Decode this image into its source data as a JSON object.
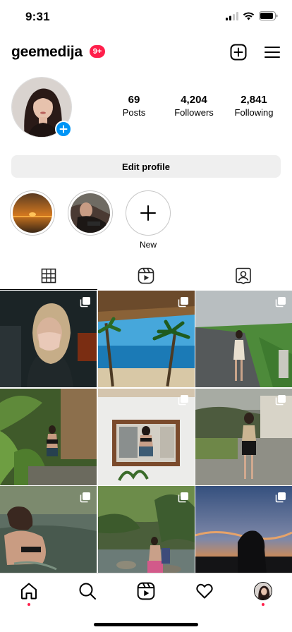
{
  "status_bar": {
    "time": "9:31"
  },
  "header": {
    "username": "geemedija",
    "notification_badge": "9+"
  },
  "profile": {
    "stats": [
      {
        "value": "69",
        "label": "Posts"
      },
      {
        "value": "4,204",
        "label": "Followers"
      },
      {
        "value": "2,841",
        "label": "Following"
      }
    ],
    "edit_profile_label": "Edit profile"
  },
  "highlights": [
    {
      "label": ""
    },
    {
      "label": ""
    },
    {
      "label": "New"
    }
  ],
  "tabs": [
    {
      "icon": "grid-icon",
      "active": true
    },
    {
      "icon": "reels-icon",
      "active": false
    },
    {
      "icon": "tagged-icon",
      "active": false
    }
  ],
  "posts": [
    {
      "scene": "girl-mask-dark",
      "multi": true
    },
    {
      "scene": "beach-palm",
      "multi": true
    },
    {
      "scene": "road-green",
      "multi": true
    },
    {
      "scene": "garden-plants",
      "multi": false
    },
    {
      "scene": "mirror-selfie",
      "multi": true
    },
    {
      "scene": "evening-dress",
      "multi": true
    },
    {
      "scene": "river-back",
      "multi": true
    },
    {
      "scene": "forest-stream",
      "multi": true
    },
    {
      "scene": "sunset-silhouette",
      "multi": true
    }
  ],
  "bottom_nav": [
    {
      "icon": "home-icon",
      "dot": true
    },
    {
      "icon": "search-icon",
      "dot": false
    },
    {
      "icon": "reels-icon",
      "dot": false
    },
    {
      "icon": "heart-icon",
      "dot": false
    },
    {
      "icon": "profile-avatar",
      "dot": true
    }
  ],
  "colors": {
    "accent_blue": "#0095f6",
    "badge_red": "#ff1f4b",
    "button_gray": "#efefef"
  }
}
